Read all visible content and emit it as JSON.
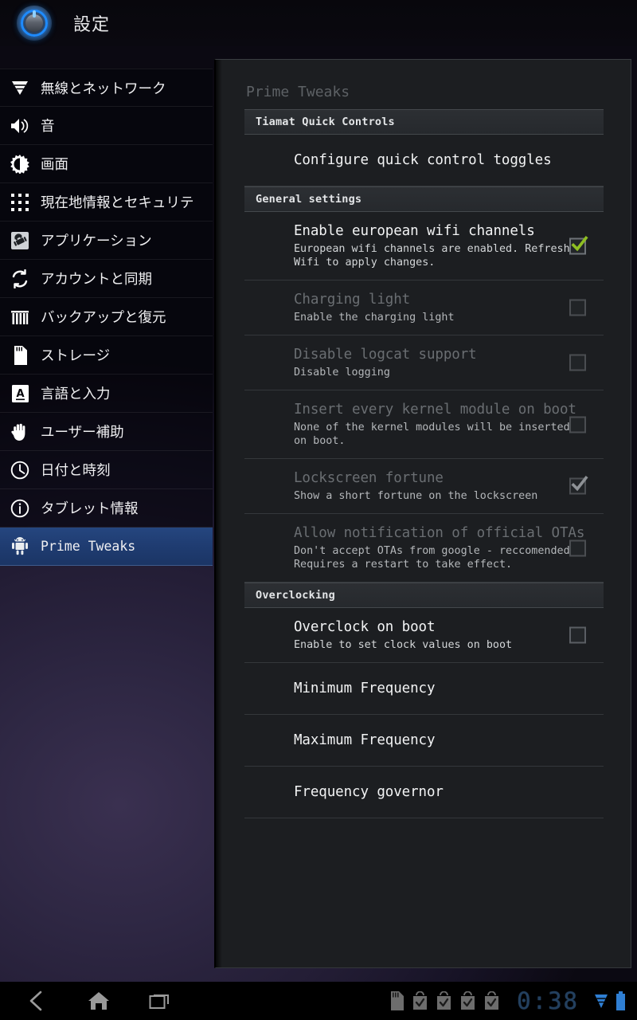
{
  "titlebar": {
    "app_icon": "settings-dial-icon",
    "title": "設定"
  },
  "sidebar": {
    "items": [
      {
        "label": "無線とネットワーク",
        "icon": "wireless-network-icon",
        "selected": false
      },
      {
        "label": "音",
        "icon": "sound-speaker-icon",
        "selected": false
      },
      {
        "label": "画面",
        "icon": "display-brightness-icon",
        "selected": false
      },
      {
        "label": "現在地情報とセキュリテ",
        "icon": "location-security-icon",
        "selected": false
      },
      {
        "label": "アプリケーション",
        "icon": "applications-icon",
        "selected": false
      },
      {
        "label": "アカウントと同期",
        "icon": "accounts-sync-icon",
        "selected": false
      },
      {
        "label": "バックアップと復元",
        "icon": "backup-restore-icon",
        "selected": false
      },
      {
        "label": "ストレージ",
        "icon": "storage-sdcard-icon",
        "selected": false
      },
      {
        "label": "言語と入力",
        "icon": "language-input-icon",
        "selected": false
      },
      {
        "label": "ユーザー補助",
        "icon": "accessibility-hand-icon",
        "selected": false
      },
      {
        "label": "日付と時刻",
        "icon": "date-time-clock-icon",
        "selected": false
      },
      {
        "label": "タブレット情報",
        "icon": "tablet-info-icon",
        "selected": false
      },
      {
        "label": "Prime Tweaks",
        "icon": "android-robot-icon",
        "selected": true
      }
    ]
  },
  "panel": {
    "title": "Prime Tweaks",
    "sections": [
      {
        "header": "Tiamat Quick Controls",
        "prefs": [
          {
            "title": "Configure quick control toggles",
            "summary": "",
            "disabled": false,
            "checkbox": "none"
          }
        ]
      },
      {
        "header": "General settings",
        "prefs": [
          {
            "title": "Enable european wifi channels",
            "summary": "European wifi channels are enabled. Refresh\nWifi to apply changes.",
            "disabled": false,
            "checkbox": "checked"
          },
          {
            "title": "Charging light",
            "summary": "Enable the charging light",
            "disabled": true,
            "checkbox": "unchecked"
          },
          {
            "title": "Disable logcat support",
            "summary": "Disable logging",
            "disabled": true,
            "checkbox": "unchecked"
          },
          {
            "title": "Insert every kernel module on boot",
            "summary": "None of the kernel modules will be inserted\non boot.",
            "disabled": true,
            "checkbox": "unchecked"
          },
          {
            "title": "Lockscreen fortune",
            "summary": "Show a short fortune on the lockscreen",
            "disabled": true,
            "checkbox": "checked-dim"
          },
          {
            "title": "Allow notification of official OTAs",
            "summary": "Don't accept OTAs from google - reccomended.\nRequires a restart to take effect.",
            "disabled": true,
            "checkbox": "unchecked"
          }
        ]
      },
      {
        "header": "Overclocking",
        "prefs": [
          {
            "title": "Overclock on boot",
            "summary": "Enable to set clock values on boot",
            "disabled": false,
            "checkbox": "unchecked"
          },
          {
            "title": "Minimum Frequency",
            "summary": "",
            "disabled": false,
            "checkbox": "none"
          },
          {
            "title": "Maximum Frequency",
            "summary": "",
            "disabled": false,
            "checkbox": "none"
          },
          {
            "title": "Frequency governor",
            "summary": "",
            "disabled": false,
            "checkbox": "none"
          }
        ]
      }
    ]
  },
  "systembar": {
    "nav": [
      {
        "name": "back-icon",
        "label": "Back"
      },
      {
        "name": "home-icon",
        "label": "Home"
      },
      {
        "name": "recent-apps-icon",
        "label": "Recent apps"
      }
    ],
    "status_icons": [
      "sdcard-icon",
      "download-bag-icon",
      "download-bag-icon",
      "download-bag-icon",
      "download-bag-icon"
    ],
    "clock": "0:38",
    "right_icons": [
      "wifi-signal-icon",
      "battery-icon"
    ]
  },
  "colors": {
    "accent_selected": "#204080",
    "check_green": "#8fbf22",
    "panel_bg": "#1c1e21",
    "status_blue": "#2f7fd4"
  }
}
